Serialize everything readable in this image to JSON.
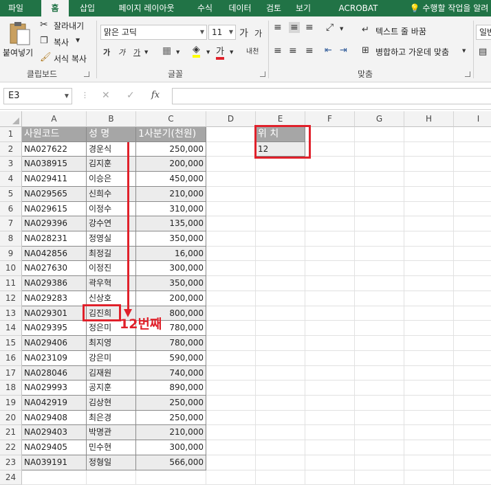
{
  "tabs": [
    "파일",
    "홈",
    "삽입",
    "페이지 레이아웃",
    "수식",
    "데이터",
    "검토",
    "보기",
    "ACROBAT",
    "수행할 작업을 알려"
  ],
  "ribbon": {
    "clipboard": {
      "paste": "붙여넣기",
      "cut": "잘라내기",
      "copy": "복사",
      "format_painter": "서식 복사",
      "label": "클립보드"
    },
    "font": {
      "name": "맑은 고딕",
      "size": "11",
      "grow": "가",
      "shrink": "가",
      "bold": "가",
      "italic": "가",
      "underline": "가",
      "font_color_label": "가",
      "phonetic": "내천",
      "label": "글꼴"
    },
    "alignment": {
      "wrap_text": "텍스트 줄 바꿈",
      "merge_center": "병합하고 가운데 맞춤",
      "label": "맞춤"
    },
    "number": {
      "format": "일반"
    }
  },
  "formula_bar": {
    "name_box": "E3",
    "fx": "fx",
    "cancel": "✕",
    "enter": "✓"
  },
  "sheet": {
    "columns": [
      "A",
      "B",
      "C",
      "D",
      "E",
      "F",
      "G",
      "H",
      "I"
    ],
    "rows": [
      1,
      2,
      3,
      4,
      5,
      6,
      7,
      8,
      9,
      10,
      11,
      12,
      13,
      14,
      15,
      16,
      17,
      18,
      19,
      20,
      21,
      22,
      23,
      24
    ],
    "headers": {
      "code": "사원코드",
      "name": "성  명",
      "q1": "1사분기(천원)",
      "position": "위 치"
    },
    "position_value": "12",
    "records": [
      {
        "code": "NA027622",
        "name": "경운식",
        "q1": "250,000"
      },
      {
        "code": "NA038915",
        "name": "김지훈",
        "q1": "200,000"
      },
      {
        "code": "NA029411",
        "name": "이승은",
        "q1": "450,000"
      },
      {
        "code": "NA029565",
        "name": "신희수",
        "q1": "210,000"
      },
      {
        "code": "NA029615",
        "name": "이정수",
        "q1": "310,000"
      },
      {
        "code": "NA029396",
        "name": "강수연",
        "q1": "135,000"
      },
      {
        "code": "NA028231",
        "name": "정영실",
        "q1": "350,000"
      },
      {
        "code": "NA042856",
        "name": "최정길",
        "q1": "16,000"
      },
      {
        "code": "NA027630",
        "name": "이정진",
        "q1": "300,000"
      },
      {
        "code": "NA029386",
        "name": "곽우혁",
        "q1": "350,000"
      },
      {
        "code": "NA029283",
        "name": "신상호",
        "q1": "200,000"
      },
      {
        "code": "NA029301",
        "name": "김진희",
        "q1": "800,000"
      },
      {
        "code": "NA029395",
        "name": "정은미",
        "q1": "780,000"
      },
      {
        "code": "NA029406",
        "name": "최지영",
        "q1": "780,000"
      },
      {
        "code": "NA023109",
        "name": "강은미",
        "q1": "590,000"
      },
      {
        "code": "NA028046",
        "name": "김재원",
        "q1": "740,000"
      },
      {
        "code": "NA029993",
        "name": "공지훈",
        "q1": "890,000"
      },
      {
        "code": "NA042919",
        "name": "김상현",
        "q1": "250,000"
      },
      {
        "code": "NA029408",
        "name": "최은경",
        "q1": "250,000"
      },
      {
        "code": "NA029403",
        "name": "박명관",
        "q1": "210,000"
      },
      {
        "code": "NA029405",
        "name": "민수현",
        "q1": "300,000"
      },
      {
        "code": "NA039191",
        "name": "정형일",
        "q1": "566,000"
      }
    ]
  },
  "annotation": {
    "text": "12번째"
  },
  "colors": {
    "excel_green": "#217346",
    "highlight_red": "#e0202a",
    "header_gray": "#a6a6a6",
    "shade_gray": "#ececec"
  }
}
